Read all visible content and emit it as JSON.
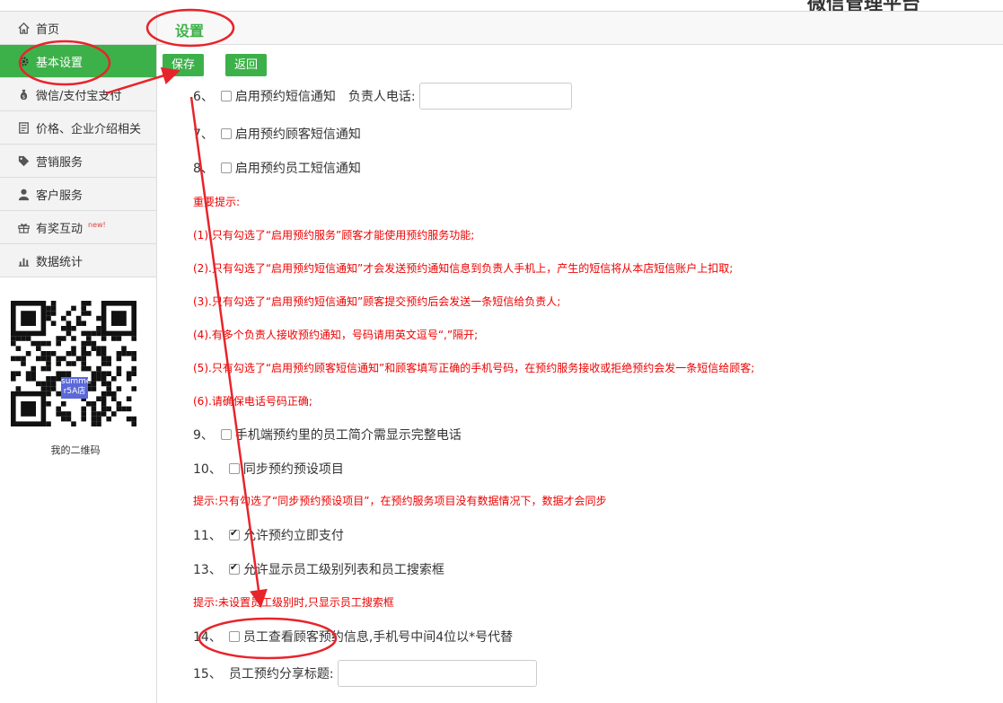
{
  "header": {
    "brand": "微信管理平台"
  },
  "sidebar": {
    "items": [
      {
        "label": "首页",
        "icon": "home-icon"
      },
      {
        "label": "基本设置",
        "icon": "gear-icon"
      },
      {
        "label": "微信/支付宝支付",
        "icon": "money-bag-icon"
      },
      {
        "label": "价格、企业介绍相关",
        "icon": "document-icon"
      },
      {
        "label": "营销服务",
        "icon": "tag-icon"
      },
      {
        "label": "客户服务",
        "icon": "user-icon"
      },
      {
        "label": "有奖互动",
        "icon": "gift-icon",
        "badge": "new!"
      },
      {
        "label": "数据统计",
        "icon": "bar-chart-icon"
      }
    ],
    "qr_caption": "我的二维码",
    "qr_center_label": "summe r5A店"
  },
  "page": {
    "title": "设置",
    "save_label": "保存",
    "back_label": "返回"
  },
  "settings": {
    "item6_num": "6、",
    "item6_label": "启用预约短信通知",
    "item6_phone_label": "负责人电话:",
    "item7_num": "7、",
    "item7_label": "启用预约顾客短信通知",
    "item8_num": "8、",
    "item8_label": "启用预约员工短信通知",
    "item9_num": "9、",
    "item9_label": "手机端预约里的员工简介需显示完整电话",
    "item10_num": "10、",
    "item10_label": "同步预约预设项目",
    "item11_num": "11、",
    "item11_label": "允许预约立即支付",
    "item13_num": "13、",
    "item13_label": "允许显示员工级别列表和员工搜索框",
    "item14_num": "14、",
    "item14_label": "员工查看顾客预约信息,手机号中间4位以*号代替",
    "item15_num": "15、",
    "item15_label": "员工预约分享标题:"
  },
  "notes": {
    "heading": "重要提示:",
    "n1": "(1).只有勾选了“启用预约服务”顾客才能使用预约服务功能;",
    "n2": "(2).只有勾选了“启用预约短信通知”才会发送预约通知信息到负责人手机上，产生的短信将从本店短信账户上扣取;",
    "n3": "(3).只有勾选了“启用预约短信通知”顾客提交预约后会发送一条短信给负责人;",
    "n4": "(4).有多个负责人接收预约通知，号码请用英文逗号“,”隔开;",
    "n5": "(5).只有勾选了“启用预约顾客短信通知”和顾客填写正确的手机号码，在预约服务接收或拒绝预约会发一条短信给顾客;",
    "n6": "(6).请确保电话号码正确;",
    "tip10": "提示:只有勾选了“同步预约预设项目”，在预约服务项目没有数据情况下，数据才会同步",
    "tip13": "提示:未设置员工级别时,只显示员工搜索框"
  },
  "colors": {
    "accent": "#3db149",
    "annotation": "#e8242b",
    "warning": "#e00000"
  }
}
